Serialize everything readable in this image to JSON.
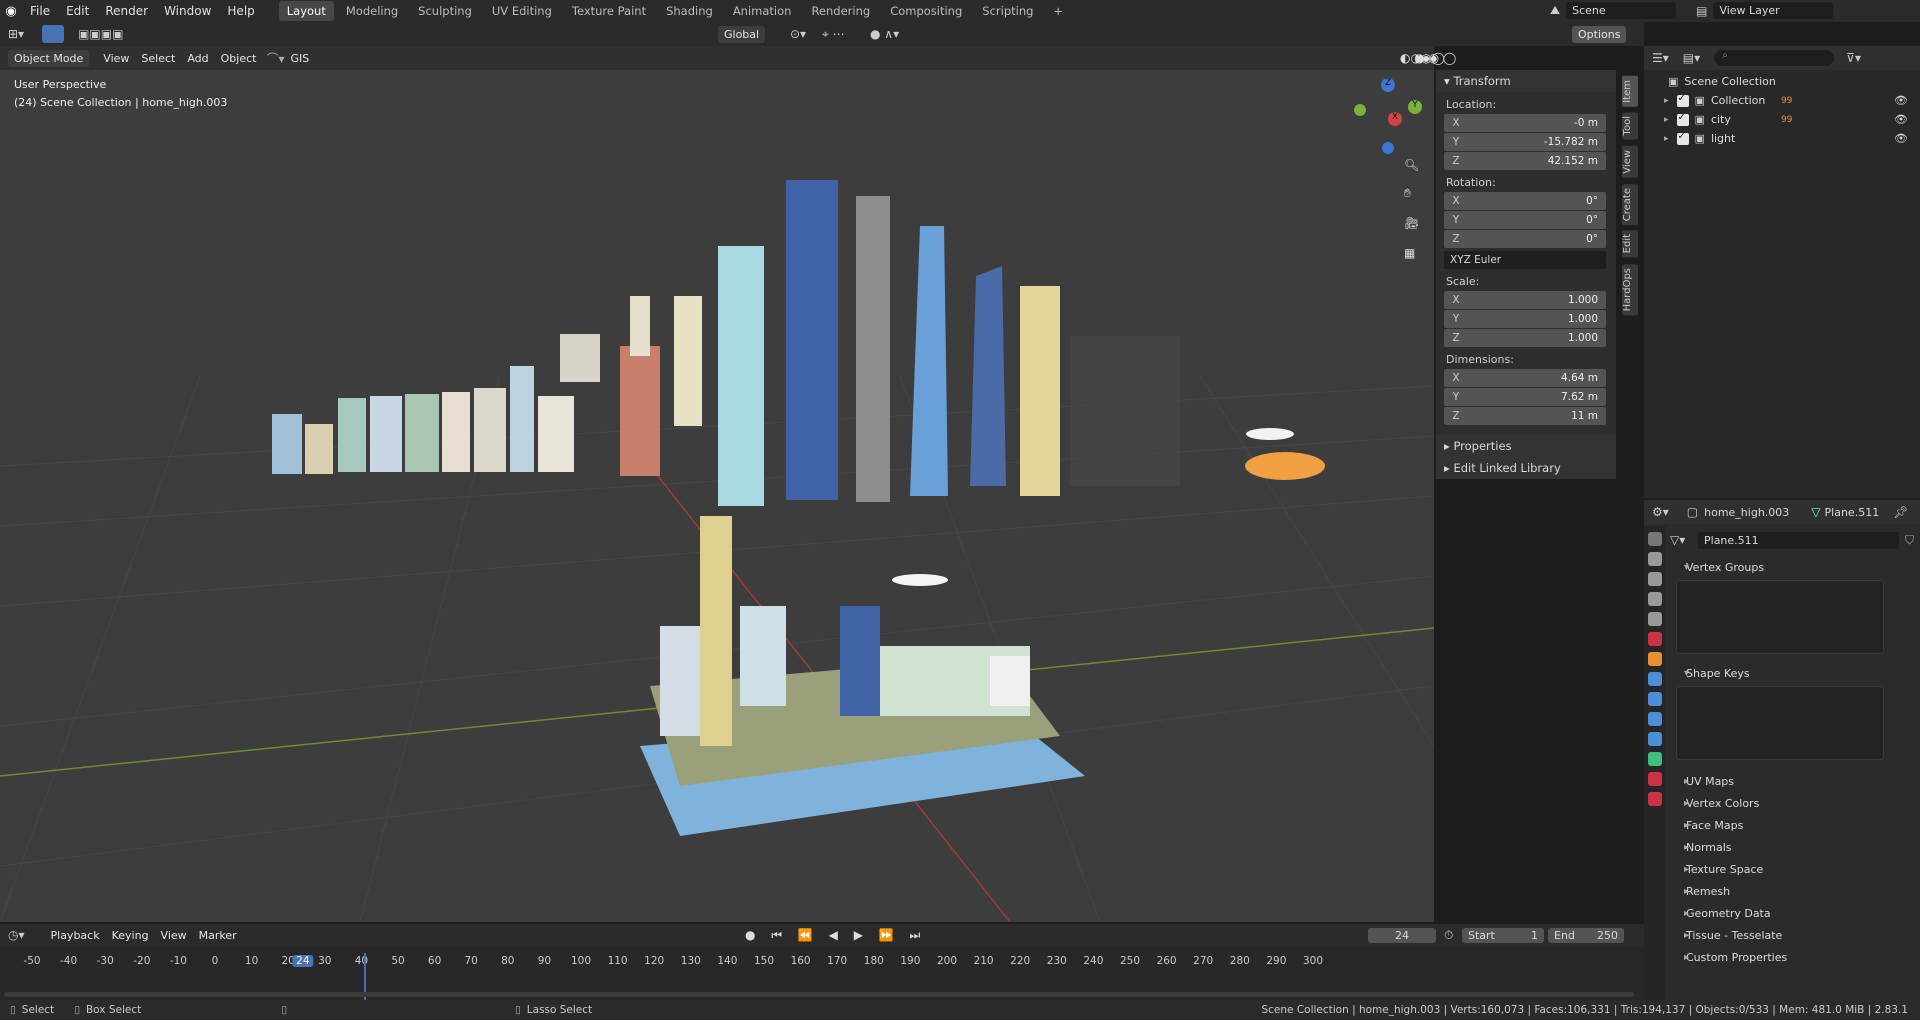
{
  "menubar": {
    "items": [
      "File",
      "Edit",
      "Render",
      "Window",
      "Help"
    ],
    "workspaces": [
      "Layout",
      "Modeling",
      "Sculpting",
      "UV Editing",
      "Texture Paint",
      "Shading",
      "Animation",
      "Rendering",
      "Compositing",
      "Scripting"
    ],
    "active": "Layout",
    "add_label": "+",
    "scene": "Scene",
    "view_layer": "View Layer"
  },
  "viewport_header": {
    "mode": "Object Mode",
    "menus": [
      "View",
      "Select",
      "Add",
      "Object"
    ],
    "gis": "GIS",
    "transform_orientation": "Global",
    "options": "Options"
  },
  "viewport": {
    "perspective": "User Perspective",
    "collection_info": "(24) Scene Collection | home_high.003",
    "gizmo": {
      "x": "X",
      "y": "Y",
      "z": "Z"
    }
  },
  "npanel": {
    "transform": "Transform",
    "location": "Location:",
    "rotation": "Rotation:",
    "scale": "Scale:",
    "dimensions": "Dimensions:",
    "loc": [
      {
        "k": "X",
        "v": "-0 m"
      },
      {
        "k": "Y",
        "v": "-15.782 m"
      },
      {
        "k": "Z",
        "v": "42.152 m"
      }
    ],
    "rot": [
      {
        "k": "X",
        "v": "0°"
      },
      {
        "k": "Y",
        "v": "0°"
      },
      {
        "k": "Z",
        "v": "0°"
      }
    ],
    "rot_mode": "XYZ Euler",
    "scl": [
      {
        "k": "X",
        "v": "1.000"
      },
      {
        "k": "Y",
        "v": "1.000"
      },
      {
        "k": "Z",
        "v": "1.000"
      }
    ],
    "dim": [
      {
        "k": "X",
        "v": "4.64 m"
      },
      {
        "k": "Y",
        "v": "7.62 m"
      },
      {
        "k": "Z",
        "v": "11 m"
      }
    ],
    "properties": "Properties",
    "edit_linked": "Edit Linked Library",
    "tabs": [
      "Item",
      "Tool",
      "View",
      "Create",
      "Edit",
      "HardOps"
    ]
  },
  "outliner": {
    "root": "Scene Collection",
    "items": [
      {
        "name": "Collection",
        "badge": "99"
      },
      {
        "name": "city",
        "badge": "99"
      },
      {
        "name": "light",
        "badge": ""
      }
    ]
  },
  "properties": {
    "object": "home_high.003",
    "mesh": "Plane.511",
    "mesh_field": "Plane.511",
    "vertex_groups": "Vertex Groups",
    "shape_keys": "Shape Keys",
    "sections": [
      "UV Maps",
      "Vertex Colors",
      "Face Maps",
      "Normals",
      "Texture Space",
      "Remesh",
      "Geometry Data",
      "Tissue - Tesselate",
      "Custom Properties"
    ]
  },
  "timeline": {
    "menus": [
      "Playback",
      "Keying",
      "View",
      "Marker"
    ],
    "current_frame": "24",
    "start_label": "Start",
    "start": "1",
    "end_label": "End",
    "end": "250",
    "ticks": [
      "-50",
      "-40",
      "-30",
      "-20",
      "-10",
      "0",
      "10",
      "20",
      "24",
      "30",
      "40",
      "50",
      "60",
      "70",
      "80",
      "90",
      "100",
      "110",
      "120",
      "130",
      "140",
      "150",
      "160",
      "170",
      "180",
      "190",
      "200",
      "210",
      "220",
      "230",
      "240",
      "250",
      "260",
      "270",
      "280",
      "290",
      "300"
    ]
  },
  "statusbar": {
    "select": "Select",
    "box_select": "Box Select",
    "lasso": "Lasso Select",
    "stats": "Scene Collection | home_high.003 | Verts:160,073 | Faces:106,331 | Tris:194,137 | Objects:0/533 | Mem: 481.0 MiB | 2.83.1"
  }
}
